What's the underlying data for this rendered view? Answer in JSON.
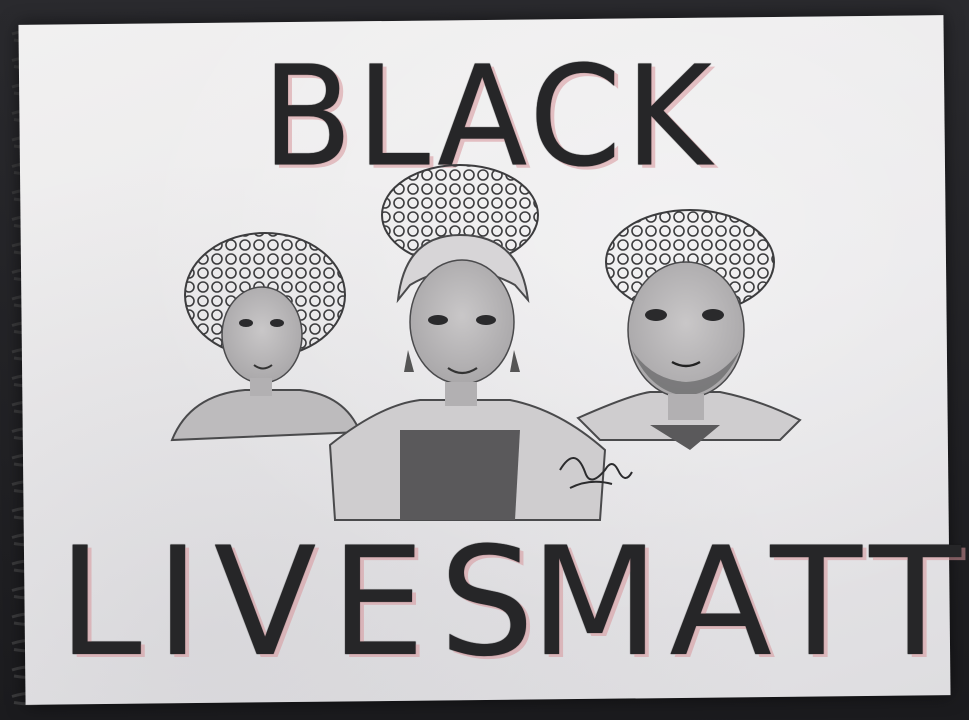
{
  "drawing": {
    "title": "BLACK",
    "bottom_line": [
      "LIVES",
      "MATTER"
    ],
    "signature": "artist-signature"
  },
  "colors": {
    "pencil": "#262628",
    "paper": "#eeedee",
    "pink_shading": "#d8969b",
    "background": "#1f1f22",
    "spiral_wire": "#3a3a3c"
  },
  "icons": [
    "spiral-binding",
    "artist-signature"
  ]
}
